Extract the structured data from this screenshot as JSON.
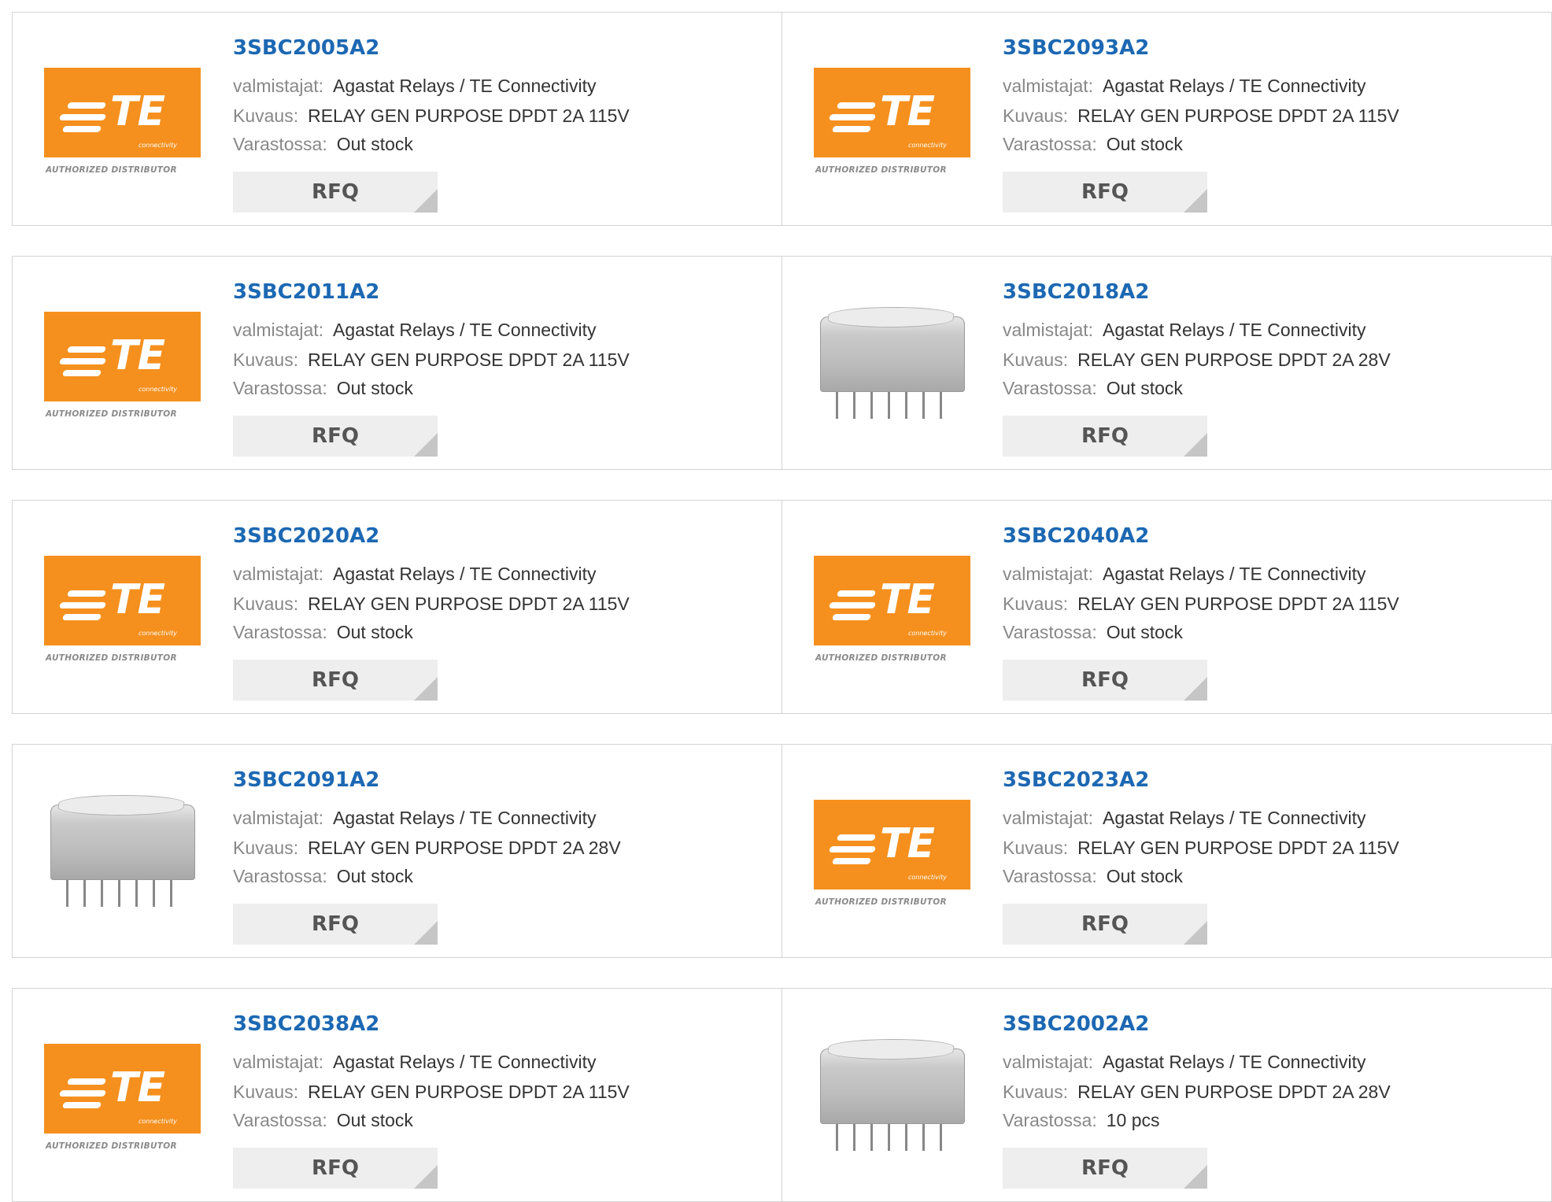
{
  "labels": {
    "manufacturer": "valmistajat:",
    "description": "Kuvaus:",
    "stock": "Varastossa:",
    "rfq": "RFQ"
  },
  "te_logo": {
    "text": "TE",
    "sub": "connectivity",
    "caption": "AUTHORIZED DISTRIBUTOR",
    "color": "#f5901e"
  },
  "colors": {
    "part_link": "#1c68b3",
    "rfq_bg": "#eeeeee"
  },
  "products": [
    {
      "part": "3SBC2005A2",
      "manufacturer": "Agastat Relays / TE Connectivity",
      "description": "RELAY GEN PURPOSE DPDT 2A 115V",
      "stock": "Out stock",
      "image": "te-logo"
    },
    {
      "part": "3SBC2093A2",
      "manufacturer": "Agastat Relays / TE Connectivity",
      "description": "RELAY GEN PURPOSE DPDT 2A 115V",
      "stock": "Out stock",
      "image": "te-logo"
    },
    {
      "part": "3SBC2011A2",
      "manufacturer": "Agastat Relays / TE Connectivity",
      "description": "RELAY GEN PURPOSE DPDT 2A 115V",
      "stock": "Out stock",
      "image": "te-logo"
    },
    {
      "part": "3SBC2018A2",
      "manufacturer": "Agastat Relays / TE Connectivity",
      "description": "RELAY GEN PURPOSE DPDT 2A 28V",
      "stock": "Out stock",
      "image": "relay-photo"
    },
    {
      "part": "3SBC2020A2",
      "manufacturer": "Agastat Relays / TE Connectivity",
      "description": "RELAY GEN PURPOSE DPDT 2A 115V",
      "stock": "Out stock",
      "image": "te-logo"
    },
    {
      "part": "3SBC2040A2",
      "manufacturer": "Agastat Relays / TE Connectivity",
      "description": "RELAY GEN PURPOSE DPDT 2A 115V",
      "stock": "Out stock",
      "image": "te-logo"
    },
    {
      "part": "3SBC2091A2",
      "manufacturer": "Agastat Relays / TE Connectivity",
      "description": "RELAY GEN PURPOSE DPDT 2A 28V",
      "stock": "Out stock",
      "image": "relay-photo"
    },
    {
      "part": "3SBC2023A2",
      "manufacturer": "Agastat Relays / TE Connectivity",
      "description": "RELAY GEN PURPOSE DPDT 2A 115V",
      "stock": "Out stock",
      "image": "te-logo"
    },
    {
      "part": "3SBC2038A2",
      "manufacturer": "Agastat Relays / TE Connectivity",
      "description": "RELAY GEN PURPOSE DPDT 2A 115V",
      "stock": "Out stock",
      "image": "te-logo"
    },
    {
      "part": "3SBC2002A2",
      "manufacturer": "Agastat Relays / TE Connectivity",
      "description": "RELAY GEN PURPOSE DPDT 2A 28V",
      "stock": "10 pcs",
      "image": "relay-photo"
    }
  ]
}
